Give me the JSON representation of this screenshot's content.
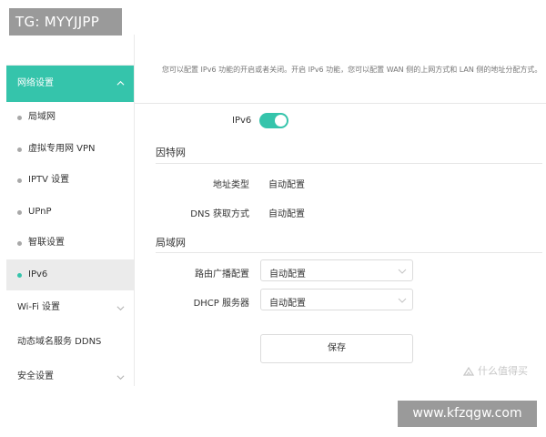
{
  "overlay": {
    "top_tag": "TG: MYYJJPP",
    "site": "www.kfzqgw.com",
    "watermark": "什么值得买"
  },
  "sidebar": {
    "active_group": "网络设置",
    "items": [
      {
        "label": "局域网"
      },
      {
        "label": "虚拟专用网 VPN"
      },
      {
        "label": "IPTV 设置"
      },
      {
        "label": "UPnP"
      },
      {
        "label": "智联设置"
      },
      {
        "label": "IPv6"
      }
    ],
    "groups": [
      {
        "label": "Wi-Fi 设置"
      },
      {
        "label": "动态域名服务 DDNS"
      },
      {
        "label": "安全设置"
      }
    ]
  },
  "main": {
    "description": "您可以配置 IPv6 功能的开启或者关闭。开启 IPv6 功能，您可以配置 WAN 侧的上网方式和 LAN 侧的地址分配方式。",
    "ipv6_label": "IPv6",
    "ipv6_enabled": true,
    "internet": {
      "title": "因特网",
      "address_type_label": "地址类型",
      "address_type_value": "自动配置",
      "dns_label": "DNS 获取方式",
      "dns_value": "自动配置"
    },
    "lan": {
      "title": "局域网",
      "route_adv_label": "路由广播配置",
      "route_adv_value": "自动配置",
      "dhcp_label": "DHCP 服务器",
      "dhcp_value": "自动配置"
    },
    "save_label": "保存"
  },
  "colors": {
    "accent": "#35c4ab",
    "selected_bg": "#ebebeb",
    "overlay_bg": "#9a9a9a"
  }
}
